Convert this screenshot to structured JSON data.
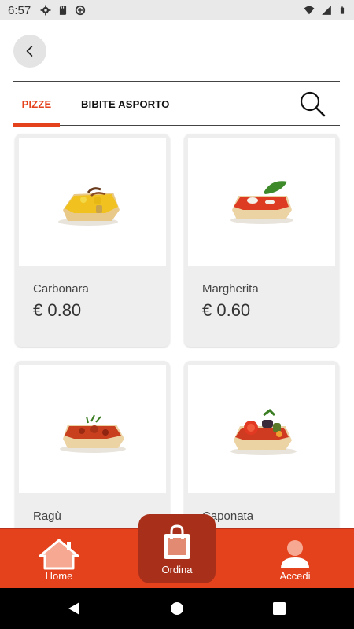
{
  "status_bar": {
    "time": "6:57",
    "left_icons": [
      "settings-icon",
      "sd-card-icon",
      "data-saver-icon"
    ],
    "right_icons": [
      "wifi-icon",
      "signal-icon",
      "battery-icon"
    ]
  },
  "header": {
    "back_icon": "chevron-left-icon"
  },
  "tabs": [
    {
      "label": "PIZZE",
      "active": true
    },
    {
      "label": "BIBITE ASPORTO",
      "active": false
    }
  ],
  "search_icon": "search-icon",
  "products": [
    {
      "name": "Carbonara",
      "price": "€ 0.80"
    },
    {
      "name": "Margherita",
      "price": "€ 0.60"
    },
    {
      "name": "Ragù",
      "price": ""
    },
    {
      "name": "Caponata",
      "price": ""
    }
  ],
  "bottom_nav": {
    "home_label": "Home",
    "ordina_label": "Ordina",
    "accedi_label": "Accedi"
  },
  "colors": {
    "accent": "#e4421d",
    "accent_dark": "#a8301a",
    "card_bg": "#eeeeee"
  }
}
